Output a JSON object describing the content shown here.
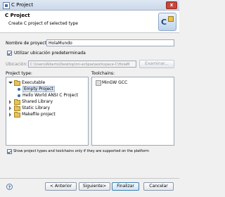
{
  "window": {
    "title": "C Project",
    "close_glyph": "x"
  },
  "banner": {
    "heading": "C Project",
    "description": "Create C project of selected type",
    "icon_letter": "C"
  },
  "form": {
    "project_name_label": "Nombre de proyecto:",
    "project_name_value": "HolaMundo",
    "default_location_label": "Utilizar ubicación predeterminada",
    "default_location_checked": true,
    "location_label": "Ubicación:",
    "location_value": "C:\\Users\\Alberto\\Desktop\\mi-eclipse\\workspace-C\\HolaM",
    "browse_label": "Examinar..."
  },
  "project_type": {
    "label": "Project type:",
    "items": [
      {
        "label": "Executable",
        "expanded": true
      },
      {
        "label": "Empty Project",
        "selected": true
      },
      {
        "label": "Hello World ANSI C Project"
      },
      {
        "label": "Shared Library"
      },
      {
        "label": "Static Library"
      },
      {
        "label": "Makefile project"
      }
    ]
  },
  "toolchains": {
    "label": "Toolchains:",
    "items": [
      {
        "label": "MinGW GCC"
      }
    ]
  },
  "show_supported": {
    "label": "Show project types and toolchains only if they are supported on the platform",
    "checked": true
  },
  "buttons": {
    "help": "?",
    "back": "< Anterior",
    "next": "Siguiente>",
    "finish": "Finalizar",
    "cancel": "Cancelar"
  }
}
